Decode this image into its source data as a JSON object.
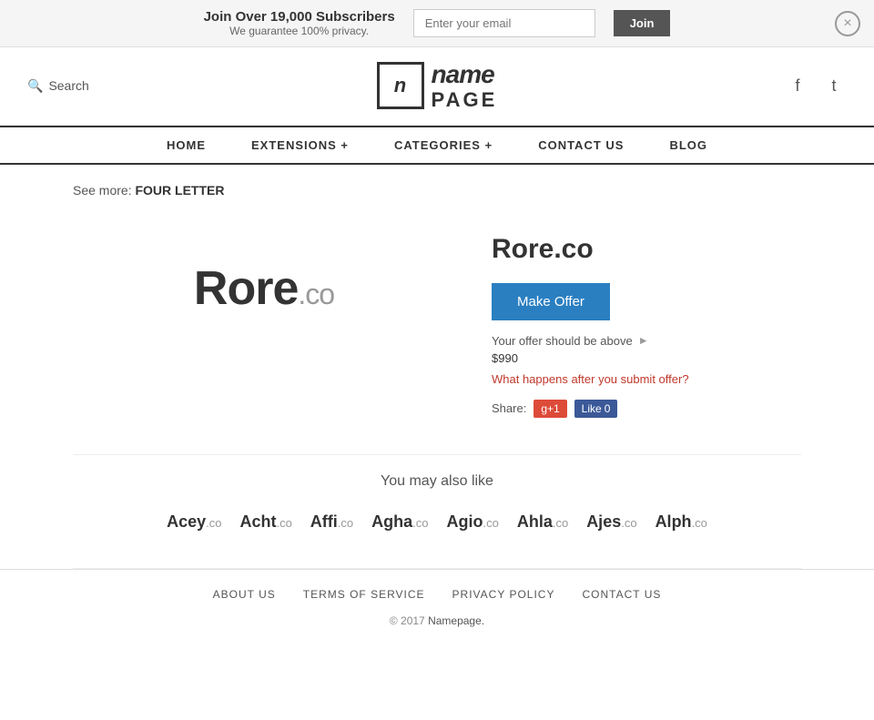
{
  "banner": {
    "title": "Join Over 19,000 Subscribers",
    "subtitle": "We guarantee 100% privacy.",
    "email_placeholder": "Enter your email",
    "join_label": "Join",
    "close_label": "×"
  },
  "header": {
    "search_label": "Search",
    "logo_icon": "n",
    "logo_name": "name",
    "logo_page": "PAGE",
    "facebook_url": "#",
    "twitter_url": "#"
  },
  "nav": {
    "items": [
      {
        "label": "HOME",
        "href": "#"
      },
      {
        "label": "EXTENSIONS +",
        "href": "#"
      },
      {
        "label": "CATEGORIES +",
        "href": "#"
      },
      {
        "label": "CONTACT US",
        "href": "#"
      },
      {
        "label": "BLOG",
        "href": "#"
      }
    ]
  },
  "breadcrumb": {
    "prefix": "See more:",
    "category": "FOUR LETTER"
  },
  "domain": {
    "name": "Rore.co",
    "name_main": "Rore",
    "name_tld": ".co",
    "display_main": "Rore",
    "display_tld": ".co",
    "make_offer_label": "Make Offer",
    "offer_info": "Your offer should be above",
    "offer_price": "$990",
    "what_happens": "What happens after you submit offer?",
    "share_label": "Share:"
  },
  "social": {
    "gplus_label": "g+1",
    "fb_like_label": "Like",
    "fb_count": "0"
  },
  "also_like": {
    "title": "You may also like",
    "domains": [
      {
        "name": "Acey",
        "tld": ".co"
      },
      {
        "name": "Acht",
        "tld": ".co"
      },
      {
        "name": "Affi",
        "tld": ".co"
      },
      {
        "name": "Agha",
        "tld": ".co"
      },
      {
        "name": "Agio",
        "tld": ".co"
      },
      {
        "name": "Ahla",
        "tld": ".co"
      },
      {
        "name": "Ajes",
        "tld": ".co"
      },
      {
        "name": "Alph",
        "tld": ".co"
      }
    ]
  },
  "footer": {
    "links": [
      {
        "label": "ABOUT US",
        "href": "#"
      },
      {
        "label": "TERMS OF SERVICE",
        "href": "#"
      },
      {
        "label": "PRIVACY POLICY",
        "href": "#"
      },
      {
        "label": "CONTACT US",
        "href": "#"
      }
    ],
    "copyright_year": "© 2017",
    "copyright_brand": "Namepage.",
    "copyright_href": "#"
  }
}
